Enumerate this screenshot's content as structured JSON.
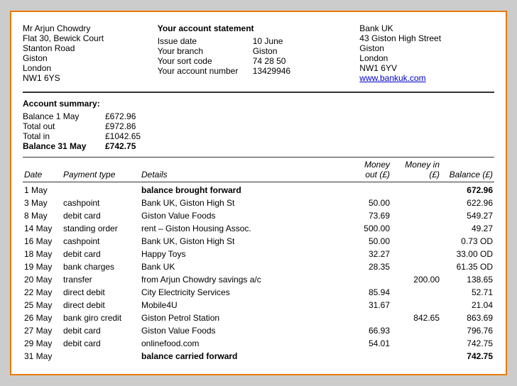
{
  "header": {
    "name": "Mr Arjun Chowdry",
    "address": [
      "Flat 30, Bewick Court",
      "Stanton Road",
      "Giston",
      "London",
      "NW1 6YS"
    ],
    "statement_title": "Your account statement",
    "fields": [
      {
        "label": "Issue date",
        "value": "10 June"
      },
      {
        "label": "Your branch",
        "value": "Giston"
      },
      {
        "label": "Your sort code",
        "value": "74 28 50"
      },
      {
        "label": "Your account number",
        "value": "13429946"
      }
    ],
    "bank_name": "Bank UK",
    "bank_address": [
      "43 Giston High Street",
      "Giston",
      "London",
      "NW1 6YV"
    ],
    "bank_website": "www.bankuk.com"
  },
  "summary": {
    "title": "Account summary:",
    "rows": [
      {
        "label": "Balance 1 May",
        "value": "£672.96",
        "bold": false
      },
      {
        "label": "Total out",
        "value": "£972.86",
        "bold": false
      },
      {
        "label": "Total in",
        "value": "£1042.65",
        "bold": false
      },
      {
        "label": "Balance 31 May",
        "value": "£742.75",
        "bold": true
      }
    ]
  },
  "table": {
    "headers": [
      {
        "label": "Date",
        "class": "col-date"
      },
      {
        "label": "Payment type",
        "class": "col-type"
      },
      {
        "label": "Details",
        "class": "col-details"
      },
      {
        "label": "Money out (£)",
        "class": "col-out num"
      },
      {
        "label": "Money in (£)",
        "class": "col-in num"
      },
      {
        "label": "Balance (£)",
        "class": "col-balance num"
      }
    ],
    "rows": [
      {
        "date": "1 May",
        "type": "",
        "details": "balance brought forward",
        "out": "",
        "in": "",
        "balance": "672.96",
        "bold_details": true,
        "bold_balance": true
      },
      {
        "date": "3 May",
        "type": "cashpoint",
        "details": "Bank UK, Giston High St",
        "out": "50.00",
        "in": "",
        "balance": "622.96",
        "bold_details": false,
        "bold_balance": false
      },
      {
        "date": "8 May",
        "type": "debit card",
        "details": "Giston Value Foods",
        "out": "73.69",
        "in": "",
        "balance": "549.27",
        "bold_details": false,
        "bold_balance": false
      },
      {
        "date": "14 May",
        "type": "standing order",
        "details": "rent – Giston Housing Assoc.",
        "out": "500.00",
        "in": "",
        "balance": "49.27",
        "bold_details": false,
        "bold_balance": false
      },
      {
        "date": "16 May",
        "type": "cashpoint",
        "details": "Bank UK, Giston High St",
        "out": "50.00",
        "in": "",
        "balance": "0.73 OD",
        "bold_details": false,
        "bold_balance": false
      },
      {
        "date": "18 May",
        "type": "debit card",
        "details": "Happy Toys",
        "out": "32.27",
        "in": "",
        "balance": "33.00 OD",
        "bold_details": false,
        "bold_balance": false
      },
      {
        "date": "19 May",
        "type": "bank charges",
        "details": "Bank UK",
        "out": "28.35",
        "in": "",
        "balance": "61.35 OD",
        "bold_details": false,
        "bold_balance": false
      },
      {
        "date": "20 May",
        "type": "transfer",
        "details": "from Arjun Chowdry savings a/c",
        "out": "",
        "in": "200.00",
        "balance": "138.65",
        "bold_details": false,
        "bold_balance": false
      },
      {
        "date": "22 May",
        "type": "direct debit",
        "details": "City Electricity Services",
        "out": "85.94",
        "in": "",
        "balance": "52.71",
        "bold_details": false,
        "bold_balance": false
      },
      {
        "date": "25 May",
        "type": "direct debit",
        "details": "Mobile4U",
        "out": "31.67",
        "in": "",
        "balance": "21.04",
        "bold_details": false,
        "bold_balance": false
      },
      {
        "date": "26 May",
        "type": "bank giro credit",
        "details": "Giston Petrol Station",
        "out": "",
        "in": "842.65",
        "balance": "863.69",
        "bold_details": false,
        "bold_balance": false
      },
      {
        "date": "27 May",
        "type": "debit card",
        "details": "Giston Value Foods",
        "out": "66.93",
        "in": "",
        "balance": "796.76",
        "bold_details": false,
        "bold_balance": false
      },
      {
        "date": "29 May",
        "type": "debit card",
        "details": "onlinefood.com",
        "out": "54.01",
        "in": "",
        "balance": "742.75",
        "bold_details": false,
        "bold_balance": false
      },
      {
        "date": "31 May",
        "type": "",
        "details": "balance carried forward",
        "out": "",
        "in": "",
        "balance": "742.75",
        "bold_details": true,
        "bold_balance": true
      }
    ]
  }
}
